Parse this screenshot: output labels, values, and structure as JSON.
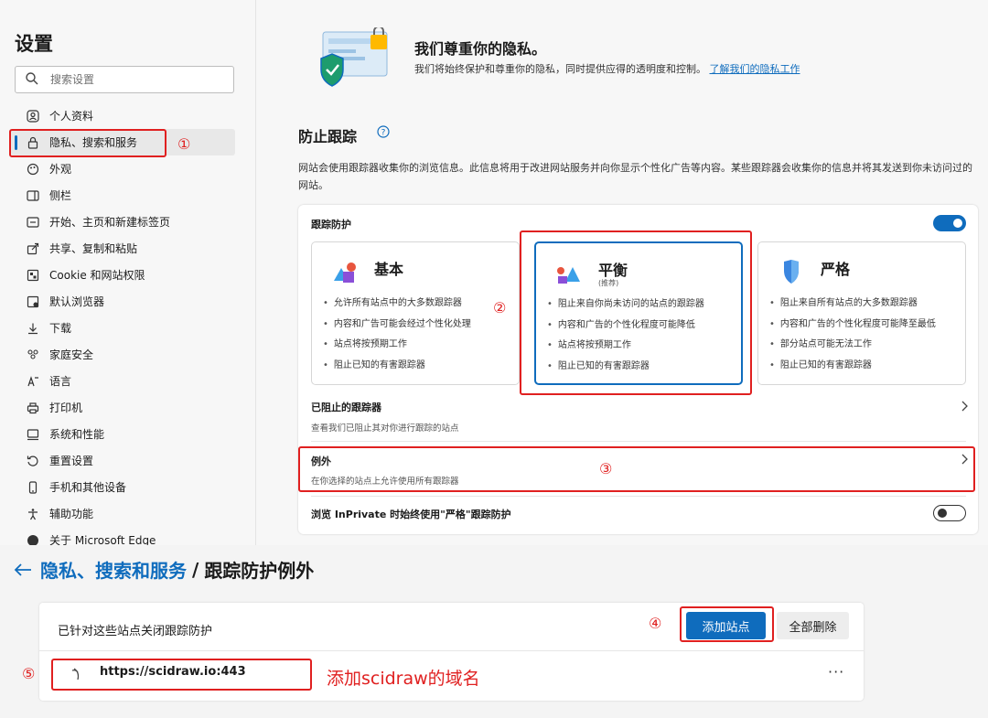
{
  "sidebar": {
    "title": "设置",
    "search_placeholder": "搜索设置",
    "items": [
      {
        "label": "个人资料",
        "icon": "profile-icon"
      },
      {
        "label": "隐私、搜索和服务",
        "icon": "lock-icon",
        "active": true
      },
      {
        "label": "外观",
        "icon": "appearance-icon"
      },
      {
        "label": "侧栏",
        "icon": "sidebar-icon"
      },
      {
        "label": "开始、主页和新建标签页",
        "icon": "home-icon"
      },
      {
        "label": "共享、复制和粘贴",
        "icon": "share-icon"
      },
      {
        "label": "Cookie 和网站权限",
        "icon": "cookie-icon"
      },
      {
        "label": "默认浏览器",
        "icon": "browser-icon"
      },
      {
        "label": "下载",
        "icon": "download-icon"
      },
      {
        "label": "家庭安全",
        "icon": "family-icon"
      },
      {
        "label": "语言",
        "icon": "language-icon"
      },
      {
        "label": "打印机",
        "icon": "printer-icon"
      },
      {
        "label": "系统和性能",
        "icon": "system-icon"
      },
      {
        "label": "重置设置",
        "icon": "reset-icon"
      },
      {
        "label": "手机和其他设备",
        "icon": "phone-icon"
      },
      {
        "label": "辅助功能",
        "icon": "accessibility-icon"
      },
      {
        "label": "关于 Microsoft Edge",
        "icon": "edge-icon"
      }
    ]
  },
  "privacy": {
    "title": "我们尊重你的隐私。",
    "desc": "我们将始终保护和尊重你的隐私，同时提供应得的透明度和控制。",
    "link": "了解我们的隐私工作"
  },
  "tracking": {
    "title": "防止跟踪",
    "desc": "网站会使用跟踪器收集你的浏览信息。此信息将用于改进网站服务并向你显示个性化广告等内容。某些跟踪器会收集你的信息并将其发送到你未访问过的网站。",
    "card_label": "跟踪防护",
    "levels": [
      {
        "name": "基本",
        "sub": "",
        "bullets": [
          "允许所有站点中的大多数跟踪器",
          "内容和广告可能会经过个性化处理",
          "站点将按预期工作",
          "阻止已知的有害跟踪器"
        ]
      },
      {
        "name": "平衡",
        "sub": "(推荐)",
        "bullets": [
          "阻止来自你尚未访问的站点的跟踪器",
          "内容和广告的个性化程度可能降低",
          "站点将按预期工作",
          "阻止已知的有害跟踪器"
        ]
      },
      {
        "name": "严格",
        "sub": "",
        "bullets": [
          "阻止来自所有站点的大多数跟踪器",
          "内容和广告的个性化程度可能降至最低",
          "部分站点可能无法工作",
          "阻止已知的有害跟踪器"
        ]
      }
    ],
    "blocked": {
      "title": "已阻止的跟踪器",
      "sub": "查看我们已阻止其对你进行跟踪的站点"
    },
    "exceptions": {
      "title": "例外",
      "sub": "在你选择的站点上允许使用所有跟踪器"
    },
    "inprivate": "浏览 InPrivate 时始终使用\"严格\"跟踪防护"
  },
  "annotations": {
    "n1": "①",
    "n2": "②",
    "n3": "③",
    "n4": "④",
    "n5": "⑤",
    "note": "添加scidraw的域名"
  },
  "exceptions_page": {
    "crumb_link": "隐私、搜索和服务",
    "crumb_sep": "/",
    "crumb_current": "跟踪防护例外",
    "label": "已针对这些站点关闭跟踪防护",
    "add_button": "添加站点",
    "remove_all_button": "全部删除",
    "site": "https://scidraw.io:443",
    "more": "···"
  },
  "colors": {
    "accent": "#0f6cbd",
    "annotation": "#e02020"
  }
}
